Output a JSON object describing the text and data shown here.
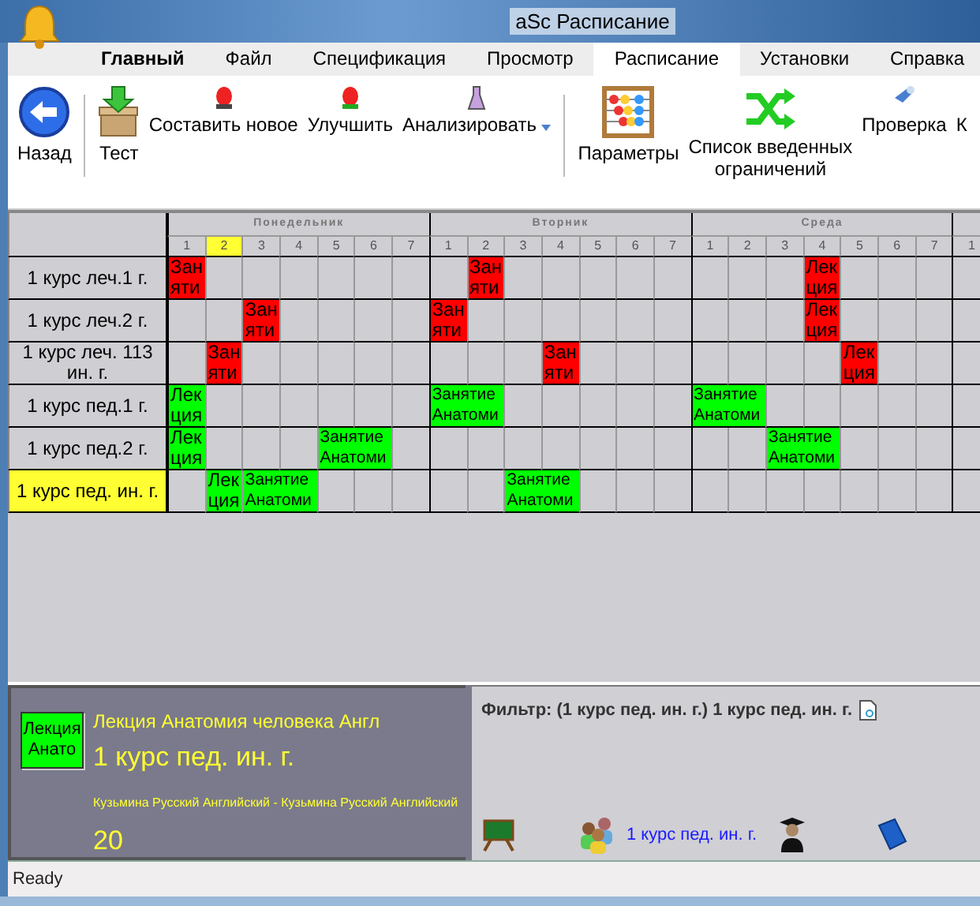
{
  "window": {
    "title": "aSc Расписание"
  },
  "tabs": [
    {
      "label": "Главный",
      "selected": false
    },
    {
      "label": "Файл",
      "selected": false
    },
    {
      "label": "Спецификация",
      "selected": false
    },
    {
      "label": "Просмотр",
      "selected": false
    },
    {
      "label": "Расписание",
      "selected": true
    },
    {
      "label": "Установки",
      "selected": false
    },
    {
      "label": "Справка",
      "selected": false
    }
  ],
  "toolbar": [
    {
      "kind": "large",
      "label": "Назад"
    },
    {
      "kind": "separator"
    },
    {
      "kind": "large",
      "label": "Тест"
    },
    {
      "kind": "small",
      "label": "Составить новое"
    },
    {
      "kind": "small",
      "label": "Улучшить"
    },
    {
      "kind": "dropdown",
      "label": "Анализировать"
    },
    {
      "kind": "separator"
    },
    {
      "kind": "large",
      "label": "Параметры"
    },
    {
      "kind": "large",
      "label": "Список введенных ограничений"
    },
    {
      "kind": "small",
      "label": "Проверка"
    },
    {
      "kind": "small",
      "label": "К"
    }
  ],
  "timetable": {
    "days": [
      {
        "name": "Понедельник",
        "periods": [
          {
            "label": "1",
            "selected": false
          },
          {
            "label": "2",
            "selected": true
          },
          {
            "label": "3",
            "selected": false
          },
          {
            "label": "4",
            "selected": false
          },
          {
            "label": "5",
            "selected": false
          },
          {
            "label": "6",
            "selected": false
          },
          {
            "label": "7",
            "selected": false
          }
        ]
      },
      {
        "name": "Вторник",
        "periods": [
          {
            "label": "1",
            "selected": false
          },
          {
            "label": "2",
            "selected": false
          },
          {
            "label": "3",
            "selected": false
          },
          {
            "label": "4",
            "selected": false
          },
          {
            "label": "5",
            "selected": false
          },
          {
            "label": "6",
            "selected": false
          },
          {
            "label": "7",
            "selected": false
          }
        ]
      },
      {
        "name": "Среда",
        "periods": [
          {
            "label": "1",
            "selected": false
          },
          {
            "label": "2",
            "selected": false
          },
          {
            "label": "3",
            "selected": false
          },
          {
            "label": "4",
            "selected": false
          },
          {
            "label": "5",
            "selected": false
          },
          {
            "label": "6",
            "selected": false
          },
          {
            "label": "7",
            "selected": false
          }
        ]
      },
      {
        "periods": [
          {
            "label": "1",
            "selected": false
          }
        ]
      }
    ],
    "rows": [
      {
        "name": "1 курс леч.1 г.",
        "selected": false,
        "days": [
          [
            {
              "kind": "single",
              "text": "Заняти",
              "color": "#ff0000"
            },
            {
              "kind": "empty"
            },
            {
              "kind": "empty"
            },
            {
              "kind": "empty"
            },
            {
              "kind": "empty"
            },
            {
              "kind": "empty"
            },
            {
              "kind": "empty"
            }
          ],
          [
            {
              "kind": "empty"
            },
            {
              "kind": "single",
              "text": "Заняти",
              "color": "#ff0000"
            },
            {
              "kind": "empty"
            },
            {
              "kind": "empty"
            },
            {
              "kind": "empty"
            },
            {
              "kind": "empty"
            },
            {
              "kind": "empty"
            }
          ],
          [
            {
              "kind": "empty"
            },
            {
              "kind": "empty"
            },
            {
              "kind": "empty"
            },
            {
              "kind": "single",
              "text": "Лекция",
              "color": "#ff0000"
            },
            {
              "kind": "empty"
            },
            {
              "kind": "empty"
            },
            {
              "kind": "empty"
            }
          ],
          [
            {
              "kind": "empty"
            }
          ]
        ]
      },
      {
        "name": "1 курс леч.2 г.",
        "selected": false,
        "days": [
          [
            {
              "kind": "empty"
            },
            {
              "kind": "empty"
            },
            {
              "kind": "single",
              "text": "Заняти",
              "color": "#ff0000"
            },
            {
              "kind": "empty"
            },
            {
              "kind": "empty"
            },
            {
              "kind": "empty"
            },
            {
              "kind": "empty"
            }
          ],
          [
            {
              "kind": "single",
              "text": "Заняти",
              "color": "#ff0000"
            },
            {
              "kind": "empty"
            },
            {
              "kind": "empty"
            },
            {
              "kind": "empty"
            },
            {
              "kind": "empty"
            },
            {
              "kind": "empty"
            },
            {
              "kind": "empty"
            }
          ],
          [
            {
              "kind": "empty"
            },
            {
              "kind": "empty"
            },
            {
              "kind": "empty"
            },
            {
              "kind": "single",
              "text": "Лекция",
              "color": "#ff0000"
            },
            {
              "kind": "empty"
            },
            {
              "kind": "empty"
            },
            {
              "kind": "empty"
            }
          ],
          [
            {
              "kind": "empty"
            }
          ]
        ]
      },
      {
        "name": "1 курс леч. 113 ин. г.",
        "selected": false,
        "days": [
          [
            {
              "kind": "empty"
            },
            {
              "kind": "single",
              "text": "Заняти",
              "color": "#ff0000"
            },
            {
              "kind": "empty"
            },
            {
              "kind": "empty"
            },
            {
              "kind": "empty"
            },
            {
              "kind": "empty"
            },
            {
              "kind": "empty"
            }
          ],
          [
            {
              "kind": "empty"
            },
            {
              "kind": "empty"
            },
            {
              "kind": "empty"
            },
            {
              "kind": "single",
              "text": "Заняти",
              "color": "#ff0000"
            },
            {
              "kind": "empty"
            },
            {
              "kind": "empty"
            },
            {
              "kind": "empty"
            }
          ],
          [
            {
              "kind": "empty"
            },
            {
              "kind": "empty"
            },
            {
              "kind": "empty"
            },
            {
              "kind": "empty"
            },
            {
              "kind": "single",
              "text": "Лекция",
              "color": "#ff0000"
            },
            {
              "kind": "empty"
            },
            {
              "kind": "empty"
            }
          ],
          [
            {
              "kind": "empty"
            }
          ]
        ]
      },
      {
        "name": "1 курс пед.1 г.",
        "selected": false,
        "days": [
          [
            {
              "kind": "single",
              "text": "Лекция",
              "color": "#00ff00"
            },
            {
              "kind": "empty"
            },
            {
              "kind": "empty"
            },
            {
              "kind": "empty"
            },
            {
              "kind": "empty"
            },
            {
              "kind": "empty"
            },
            {
              "kind": "empty"
            }
          ],
          [
            {
              "kind": "double",
              "text": "Занятие Анатоми",
              "color": "#00ff00"
            },
            {
              "kind": "empty"
            },
            {
              "kind": "empty"
            },
            {
              "kind": "empty"
            },
            {
              "kind": "empty"
            },
            {
              "kind": "empty"
            }
          ],
          [
            {
              "kind": "double",
              "text": "Занятие Анатоми",
              "color": "#00ff00"
            },
            {
              "kind": "empty"
            },
            {
              "kind": "empty"
            },
            {
              "kind": "empty"
            },
            {
              "kind": "empty"
            },
            {
              "kind": "empty"
            }
          ],
          [
            {
              "kind": "empty"
            }
          ]
        ]
      },
      {
        "name": "1 курс пед.2 г.",
        "selected": false,
        "days": [
          [
            {
              "kind": "single",
              "text": "Лекция",
              "color": "#00ff00"
            },
            {
              "kind": "empty"
            },
            {
              "kind": "empty"
            },
            {
              "kind": "empty"
            },
            {
              "kind": "double",
              "text": "Занятие Анатоми",
              "color": "#00ff00"
            },
            {
              "kind": "empty"
            }
          ],
          [
            {
              "kind": "empty"
            },
            {
              "kind": "empty"
            },
            {
              "kind": "empty"
            },
            {
              "kind": "empty"
            },
            {
              "kind": "empty"
            },
            {
              "kind": "empty"
            },
            {
              "kind": "empty"
            }
          ],
          [
            {
              "kind": "empty"
            },
            {
              "kind": "empty"
            },
            {
              "kind": "double",
              "text": "Занятие Анатоми",
              "color": "#00ff00"
            },
            {
              "kind": "empty"
            },
            {
              "kind": "empty"
            },
            {
              "kind": "empty"
            }
          ],
          [
            {
              "kind": "empty"
            }
          ]
        ]
      },
      {
        "name": "1 курс пед. ин. г.",
        "selected": true,
        "days": [
          [
            {
              "kind": "empty"
            },
            {
              "kind": "single",
              "text": "Лекция",
              "color": "#00ff00"
            },
            {
              "kind": "double",
              "text": "Занятие Анатоми",
              "color": "#00ff00"
            },
            {
              "kind": "empty"
            },
            {
              "kind": "empty"
            },
            {
              "kind": "empty"
            }
          ],
          [
            {
              "kind": "empty"
            },
            {
              "kind": "empty"
            },
            {
              "kind": "double",
              "text": "Занятие Анатоми",
              "color": "#00ff00"
            },
            {
              "kind": "empty"
            },
            {
              "kind": "empty"
            },
            {
              "kind": "empty"
            }
          ],
          [
            {
              "kind": "empty"
            },
            {
              "kind": "empty"
            },
            {
              "kind": "empty"
            },
            {
              "kind": "empty"
            },
            {
              "kind": "empty"
            },
            {
              "kind": "empty"
            },
            {
              "kind": "empty"
            }
          ],
          [
            {
              "kind": "empty"
            }
          ]
        ]
      }
    ]
  },
  "details": {
    "chip": {
      "text": "Лекция Анато",
      "color": "#00ff00"
    },
    "subject": "Лекция Анатомия человека Англ",
    "class": "1 курс пед. ин. г.",
    "teachers": "Кузьмина Русский Английский - Кузьмина Русский Английский",
    "count": "20"
  },
  "filter": {
    "text": "Фильтр: (1 курс пед. ин. г.) 1 курс пед. ин. г.",
    "links": [
      {
        "kind": "icon"
      },
      {
        "kind": "labeled",
        "label": "1 курс пед. ин. г."
      },
      {
        "kind": "icon"
      },
      {
        "kind": "icon"
      }
    ]
  },
  "status_bar": {
    "text": "Ready"
  }
}
